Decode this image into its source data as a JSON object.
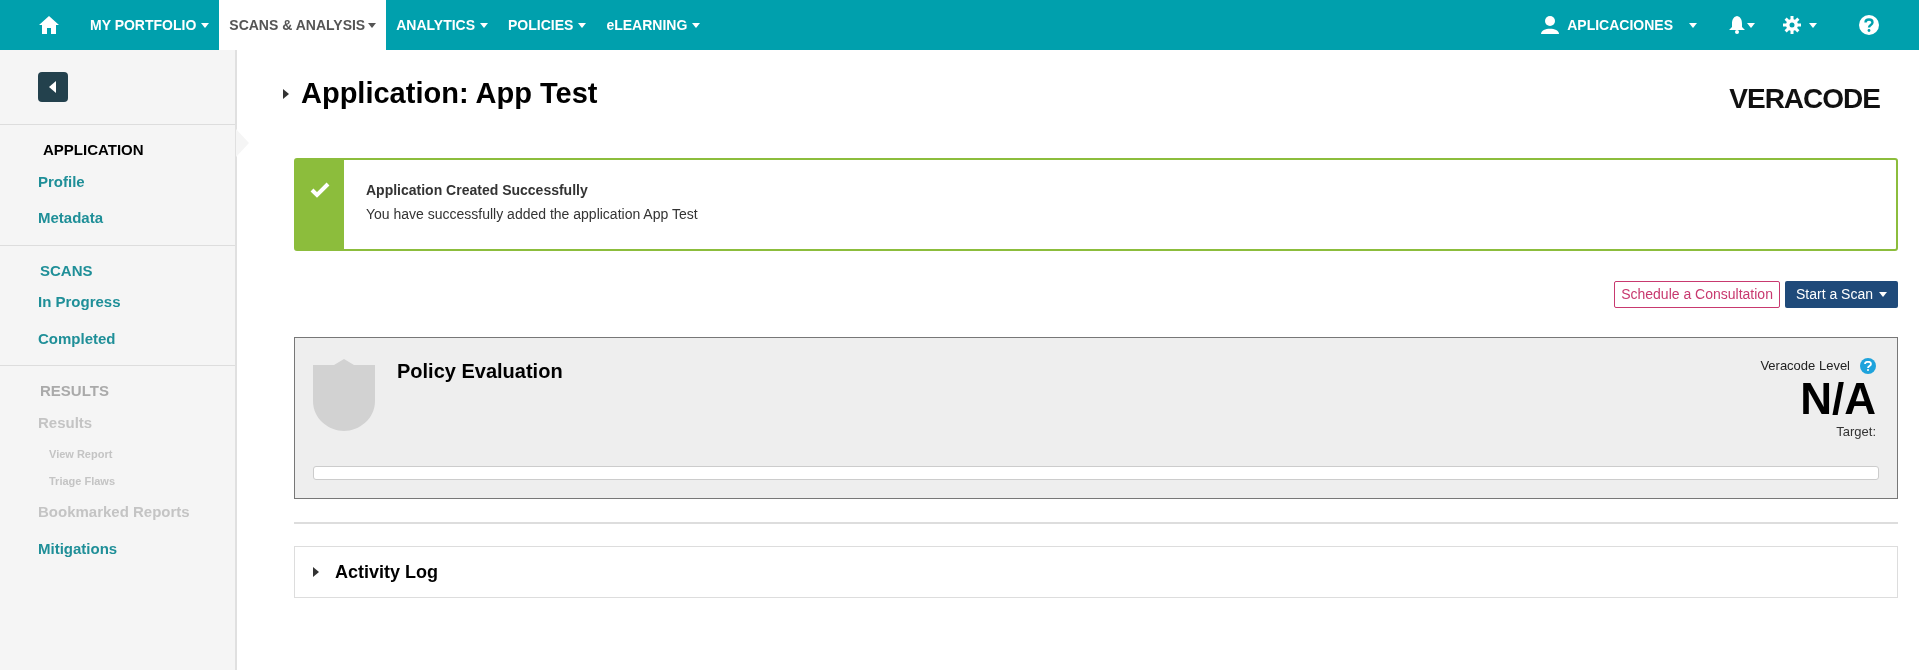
{
  "nav": {
    "items": [
      {
        "label": "MY PORTFOLIO",
        "selected": false
      },
      {
        "label": "SCANS & ANALYSIS",
        "selected": true
      },
      {
        "label": "ANALYTICS",
        "selected": false
      },
      {
        "label": "POLICIES",
        "selected": false
      },
      {
        "label": "eLEARNING",
        "selected": false
      }
    ],
    "user_menu": "APLICACIONES"
  },
  "sidebar": {
    "sections": [
      {
        "heading": "APPLICATION",
        "selected": true,
        "disabled": false,
        "items": [
          {
            "label": "Profile",
            "kind": "link",
            "disabled": false
          },
          {
            "label": "Metadata",
            "kind": "link",
            "disabled": false
          }
        ]
      },
      {
        "heading": "SCANS",
        "selected": false,
        "disabled": false,
        "items": [
          {
            "label": "In Progress",
            "kind": "link",
            "disabled": false
          },
          {
            "label": "Completed",
            "kind": "link",
            "disabled": false
          }
        ]
      },
      {
        "heading": "RESULTS",
        "selected": false,
        "disabled": true,
        "items": [
          {
            "label": "Results",
            "kind": "link",
            "disabled": true
          },
          {
            "label": "View Report",
            "kind": "sublink",
            "disabled": true
          },
          {
            "label": "Triage Flaws",
            "kind": "sublink",
            "disabled": true
          },
          {
            "label": "Bookmarked Reports",
            "kind": "link",
            "disabled": true
          },
          {
            "label": "Mitigations",
            "kind": "link",
            "disabled": false
          }
        ]
      }
    ]
  },
  "page": {
    "title": "Application: App Test",
    "logo": "VERACODE"
  },
  "alert": {
    "title": "Application Created Successfully",
    "message": "You have successfully added the application App Test"
  },
  "actions": {
    "consult": "Schedule a Consultation",
    "scan": "Start a Scan"
  },
  "policy": {
    "title": "Policy Evaluation",
    "level_label": "Veracode Level",
    "level_value": "N/A",
    "target": "Target:",
    "level": 0
  },
  "activity_log": {
    "title": "Activity Log",
    "expanded": false
  }
}
